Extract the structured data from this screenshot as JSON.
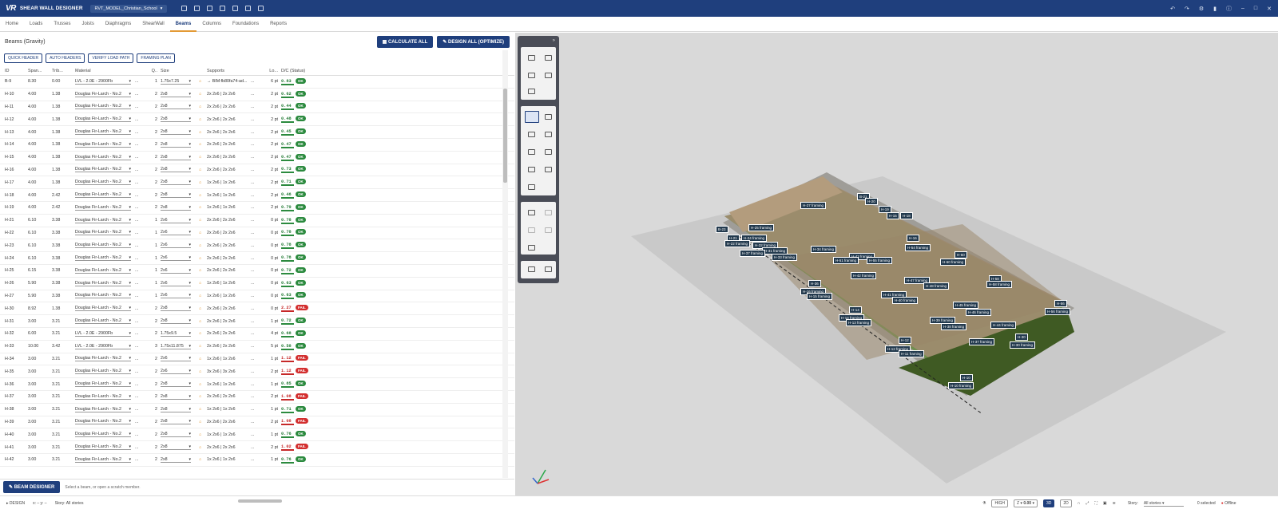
{
  "app": {
    "logo": "VR",
    "title": "SHEAR WALL DESIGNER",
    "project": "RVT_MODEL_Christian_School"
  },
  "menu": [
    "Home",
    "Loads",
    "Trusses",
    "Joists",
    "Diaphragms",
    "ShearWall",
    "Beams",
    "Columns",
    "Foundations",
    "Reports"
  ],
  "left": {
    "title": "Beams (Gravity)",
    "calculate_label": "CALCULATE ALL",
    "design_label": "DESIGN ALL (OPTIMIZE)",
    "buttons": [
      "QUICK HEADER",
      "AUTO HEADERS",
      "VERIFY LOAD PATH",
      "FRAMING PLAN"
    ],
    "columns": [
      "ID",
      "Span...",
      "Trib...",
      "Material",
      "Q..",
      "Size",
      "Supports",
      "Lo...",
      "D/C (Status)"
    ],
    "rows": [
      [
        "B-9",
        "8.30",
        "0.00",
        "LVL - 2.0E - 2900Fb",
        "1",
        "1.75x7.25",
        "→ BIM:fb80fa74-ad...",
        "6 pt",
        "0.83",
        "OK"
      ],
      [
        "H-10",
        "4.00",
        "1.38",
        "Douglas Fir-Larch - No.2",
        "2",
        "2x8",
        "2x 2x6 | 2x 2x6",
        "2 pt",
        "0.62",
        "OK"
      ],
      [
        "H-11",
        "4.00",
        "1.38",
        "Douglas Fir-Larch - No.2",
        "2",
        "2x8",
        "2x 2x6 | 2x 2x6",
        "2 pt",
        "0.44",
        "OK"
      ],
      [
        "H-12",
        "4.00",
        "1.38",
        "Douglas Fir-Larch - No.2",
        "2",
        "2x8",
        "2x 2x6 | 2x 2x6",
        "2 pt",
        "0.48",
        "OK"
      ],
      [
        "H-13",
        "4.00",
        "1.38",
        "Douglas Fir-Larch - No.2",
        "2",
        "2x8",
        "2x 2x6 | 2x 2x6",
        "2 pt",
        "0.45",
        "OK"
      ],
      [
        "H-14",
        "4.00",
        "1.38",
        "Douglas Fir-Larch - No.2",
        "2",
        "2x8",
        "2x 2x6 | 2x 2x6",
        "2 pt",
        "0.47",
        "OK"
      ],
      [
        "H-15",
        "4.00",
        "1.38",
        "Douglas Fir-Larch - No.2",
        "2",
        "2x8",
        "2x 2x6 | 2x 2x6",
        "2 pt",
        "0.47",
        "OK"
      ],
      [
        "H-16",
        "4.00",
        "1.38",
        "Douglas Fir-Larch - No.2",
        "2",
        "2x8",
        "2x 2x6 | 2x 2x6",
        "2 pt",
        "0.73",
        "OK"
      ],
      [
        "H-17",
        "4.00",
        "1.38",
        "Douglas Fir-Larch - No.2",
        "2",
        "2x8",
        "1x 2x6 | 1x 2x6",
        "2 pt",
        "0.71",
        "OK"
      ],
      [
        "H-18",
        "4.00",
        "2.42",
        "Douglas Fir-Larch - No.2",
        "2",
        "2x8",
        "1x 2x6 | 1x 2x6",
        "2 pt",
        "0.46",
        "OK"
      ],
      [
        "H-19",
        "4.00",
        "2.42",
        "Douglas Fir-Larch - No.2",
        "2",
        "2x8",
        "1x 2x6 | 1x 2x6",
        "2 pt",
        "0.79",
        "OK"
      ],
      [
        "H-21",
        "6.10",
        "3.38",
        "Douglas Fir-Larch - No.2",
        "1",
        "2x6",
        "2x 2x6 | 2x 2x6",
        "0 pt",
        "0.78",
        "OK"
      ],
      [
        "H-22",
        "6.10",
        "3.38",
        "Douglas Fir-Larch - No.2",
        "1",
        "2x6",
        "2x 2x6 | 2x 2x6",
        "0 pt",
        "0.78",
        "OK"
      ],
      [
        "H-23",
        "6.10",
        "3.38",
        "Douglas Fir-Larch - No.2",
        "1",
        "2x6",
        "2x 2x6 | 2x 2x6",
        "0 pt",
        "0.78",
        "OK"
      ],
      [
        "H-24",
        "6.10",
        "3.38",
        "Douglas Fir-Larch - No.2",
        "1",
        "2x6",
        "2x 2x6 | 2x 2x6",
        "0 pt",
        "0.78",
        "OK"
      ],
      [
        "H-25",
        "6.15",
        "3.38",
        "Douglas Fir-Larch - No.2",
        "1",
        "2x6",
        "2x 2x6 | 2x 2x6",
        "0 pt",
        "0.72",
        "OK"
      ],
      [
        "H-26",
        "5.90",
        "3.38",
        "Douglas Fir-Larch - No.2",
        "1",
        "2x6",
        "1x 2x6 | 1x 2x6",
        "0 pt",
        "0.63",
        "OK"
      ],
      [
        "H-27",
        "5.90",
        "3.38",
        "Douglas Fir-Larch - No.2",
        "1",
        "2x6",
        "1x 2x6 | 1x 2x6",
        "0 pt",
        "0.63",
        "OK"
      ],
      [
        "H-30",
        "8.92",
        "1.38",
        "Douglas Fir-Larch - No.2",
        "2",
        "2x8",
        "2x 2x6 | 2x 2x6",
        "0 pt",
        "2.27",
        "FAIL"
      ],
      [
        "H-31",
        "3.00",
        "3.21",
        "Douglas Fir-Larch - No.2",
        "2",
        "2x8",
        "2x 2x6 | 2x 2x6",
        "1 pt",
        "0.72",
        "OK"
      ],
      [
        "H-32",
        "6.00",
        "3.21",
        "LVL - 2.0E - 2900Fb",
        "2",
        "1.75x9.5",
        "2x 2x6 | 2x 2x6",
        "4 pt",
        "0.68",
        "OK"
      ],
      [
        "H-33",
        "10.00",
        "3.42",
        "LVL - 2.0E - 2900Fb",
        "3",
        "1.75x11.875",
        "2x 2x6 | 2x 2x6",
        "5 pt",
        "0.58",
        "OK"
      ],
      [
        "H-34",
        "3.00",
        "3.21",
        "Douglas Fir-Larch - No.2",
        "2",
        "2x6",
        "1x 2x6 | 1x 2x6",
        "1 pt",
        "1.12",
        "FAIL"
      ],
      [
        "H-35",
        "3.00",
        "3.21",
        "Douglas Fir-Larch - No.2",
        "2",
        "2x6",
        "3x 2x6 | 3x 2x6",
        "2 pt",
        "1.12",
        "FAIL"
      ],
      [
        "H-36",
        "3.00",
        "3.21",
        "Douglas Fir-Larch - No.2",
        "2",
        "2x8",
        "1x 2x6 | 1x 2x6",
        "1 pt",
        "0.85",
        "OK"
      ],
      [
        "H-37",
        "3.00",
        "3.21",
        "Douglas Fir-Larch - No.2",
        "2",
        "2x8",
        "2x 2x6 | 2x 2x6",
        "2 pt",
        "1.08",
        "FAIL"
      ],
      [
        "H-38",
        "3.00",
        "3.21",
        "Douglas Fir-Larch - No.2",
        "2",
        "2x8",
        "1x 2x6 | 1x 2x6",
        "1 pt",
        "0.71",
        "OK"
      ],
      [
        "H-39",
        "3.00",
        "3.21",
        "Douglas Fir-Larch - No.2",
        "2",
        "2x8",
        "2x 2x6 | 2x 2x6",
        "2 pt",
        "1.08",
        "FAIL"
      ],
      [
        "H-40",
        "3.00",
        "3.21",
        "Douglas Fir-Larch - No.2",
        "2",
        "2x8",
        "1x 2x6 | 1x 2x6",
        "1 pt",
        "0.76",
        "OK"
      ],
      [
        "H-41",
        "3.00",
        "3.21",
        "Douglas Fir-Larch - No.2",
        "2",
        "2x8",
        "2x 2x6 | 2x 2x6",
        "2 pt",
        "1.02",
        "FAIL"
      ],
      [
        "H-42",
        "3.00",
        "3.21",
        "Douglas Fir-Larch - No.2",
        "2",
        "2x8",
        "1x 2x6 | 1x 2x6",
        "1 pt",
        "0.76",
        "OK"
      ]
    ],
    "footer_button": "BEAM DESIGNER",
    "footer_hint": "Select a beam, or open a scratch member."
  },
  "status": {
    "mode": "DESIGN",
    "story": "Story: All stories",
    "quality": "HIGH",
    "zoom": "0.00",
    "view_3d": "3D",
    "view_2d": "2D",
    "story_label": "Story:",
    "story_value": "All stories",
    "selected": "0 selected",
    "offline": "Offline"
  },
  "labels": [
    "B-21",
    "H-20",
    "H-19",
    "H-15",
    "H-18",
    "H-27 framing",
    "B-23",
    "H-25 framing",
    "H-21",
    "H-24 framing",
    "H-22 framing",
    "H-32 framing",
    "H-31 framing",
    "H-37 framing",
    "H-33 framing",
    "H-34 framing",
    "H-43 framing",
    "H-51 framing",
    "H-55 framing",
    "H-54 framing",
    "H-16",
    "H-60",
    "H-60 framing",
    "H-42 framing",
    "H-36",
    "H-16 framing",
    "H-15 framing",
    "H-47 framing",
    "H-48 framing",
    "H-58",
    "H-58 framing",
    "H-41 framing",
    "H-40 framing",
    "H-45 framing",
    "H-46 framing",
    "H-56",
    "H-56 framing",
    "H-14",
    "H-14 framing",
    "H-13 framing",
    "H-39 framing",
    "H-38 framing",
    "H-44 framing",
    "H-12",
    "H-12 framing",
    "H-11 framing",
    "H-30",
    "H-37 framing",
    "H-30 framing",
    "H-10",
    "H-10 framing"
  ]
}
